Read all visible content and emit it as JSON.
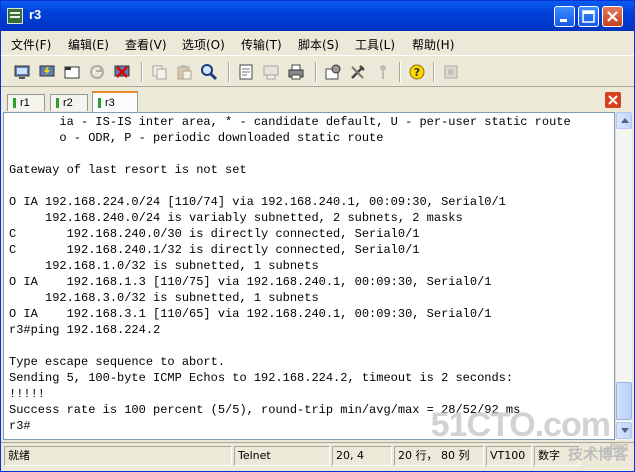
{
  "window": {
    "title": "r3"
  },
  "menu": [
    {
      "label": "文件(F)"
    },
    {
      "label": "编辑(E)"
    },
    {
      "label": "查看(V)"
    },
    {
      "label": "选项(O)"
    },
    {
      "label": "传输(T)"
    },
    {
      "label": "脚本(S)"
    },
    {
      "label": "工具(L)"
    },
    {
      "label": "帮助(H)"
    }
  ],
  "toolbar": [
    {
      "icon": "connect-icon"
    },
    {
      "icon": "quick-connect-icon"
    },
    {
      "icon": "connect-tab-icon"
    },
    {
      "icon": "reconnect-icon"
    },
    {
      "icon": "disconnect-icon"
    },
    {
      "icon": "copy-icon"
    },
    {
      "icon": "paste-icon"
    },
    {
      "icon": "find-icon"
    },
    {
      "icon": "print-setup-icon"
    },
    {
      "icon": "print-screen-icon"
    },
    {
      "icon": "print-icon"
    },
    {
      "icon": "session-options-icon"
    },
    {
      "icon": "global-options-icon"
    },
    {
      "icon": "keymap-icon"
    },
    {
      "icon": "help-icon"
    },
    {
      "icon": "about-icon"
    }
  ],
  "tabs": [
    {
      "label": "r1",
      "active": false
    },
    {
      "label": "r2",
      "active": false
    },
    {
      "label": "r3",
      "active": true
    }
  ],
  "terminal": {
    "lines": [
      "       ia - IS-IS inter area, * - candidate default, U - per-user static route",
      "       o - ODR, P - periodic downloaded static route",
      "",
      "Gateway of last resort is not set",
      "",
      "O IA 192.168.224.0/24 [110/74] via 192.168.240.1, 00:09:30, Serial0/1",
      "     192.168.240.0/24 is variably subnetted, 2 subnets, 2 masks",
      "C       192.168.240.0/30 is directly connected, Serial0/1",
      "C       192.168.240.1/32 is directly connected, Serial0/1",
      "     192.168.1.0/32 is subnetted, 1 subnets",
      "O IA    192.168.1.3 [110/75] via 192.168.240.1, 00:09:30, Serial0/1",
      "     192.168.3.0/32 is subnetted, 1 subnets",
      "O IA    192.168.3.1 [110/65] via 192.168.240.1, 00:09:30, Serial0/1",
      "r3#ping 192.168.224.2",
      "",
      "Type escape sequence to abort.",
      "Sending 5, 100-byte ICMP Echos to 192.168.224.2, timeout is 2 seconds:",
      "!!!!!",
      "Success rate is 100 percent (5/5), round-trip min/avg/max = 28/52/92 ms",
      "r3#"
    ]
  },
  "status": {
    "ready": "就绪",
    "protocol": "Telnet",
    "position": "20,  4",
    "rows": "20 行， 80 列",
    "terminal_type": "VT100",
    "caps": "数字"
  },
  "watermark": {
    "big": "51CTO.com",
    "small": "技术博客",
    "blog": "Blog"
  },
  "colors": {
    "titlebar": "#0041d8",
    "terminal_bg": "#ffffff",
    "active_tab_accent": "#e68b2c"
  }
}
